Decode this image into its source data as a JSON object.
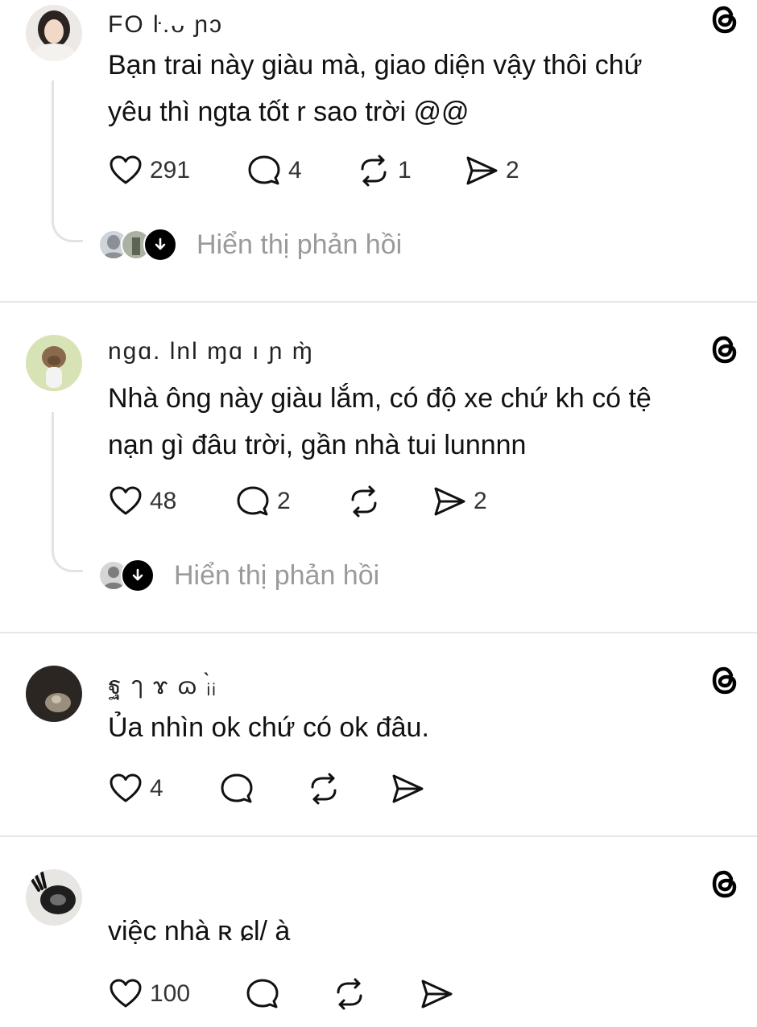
{
  "comments": [
    {
      "username": "FO ŀ.ᴗ ɲɔ",
      "text_line1": "Bạn trai này giàu mà, giao diện vậy thôi chứ",
      "text_line2": "yêu thì ngta tốt r sao trời @@",
      "likes": "291",
      "replies": "4",
      "reposts": "1",
      "shares": "2",
      "show_replies": "Hiển thị phản hồi"
    },
    {
      "username": "ngɑ. lnl ɱɑ ı ɲ ɱ̀",
      "text_line1": "Nhà ông này giàu lắm, có độ xe chứ kh có tệ",
      "text_line2": "nạn gì đâu trời, gần nhà tui lunnnn",
      "likes": "48",
      "replies": "2",
      "reposts": "",
      "shares": "2",
      "show_replies": "Hiển thị phản hồi"
    },
    {
      "username": "ฐ ๅ   ɤ  ɷ   ᵢ̀ᵢ",
      "text_line1": "Ủa nhìn ok chứ có ok đâu.",
      "likes": "4",
      "replies": "",
      "reposts": "",
      "shares": ""
    },
    {
      "username": "",
      "text_line1": "việc nhà ʀ ɕl/ à",
      "likes": "100",
      "replies": "",
      "reposts": "",
      "shares": ""
    }
  ],
  "icons": {
    "like": "heart-icon",
    "reply": "comment-icon",
    "repost": "repost-icon",
    "share": "send-icon",
    "threads": "threads-logo-icon",
    "expand": "arrow-down-icon"
  },
  "colors": {
    "text": "#111111",
    "muted": "#9a9a9a",
    "divider": "#e6e6e6"
  }
}
